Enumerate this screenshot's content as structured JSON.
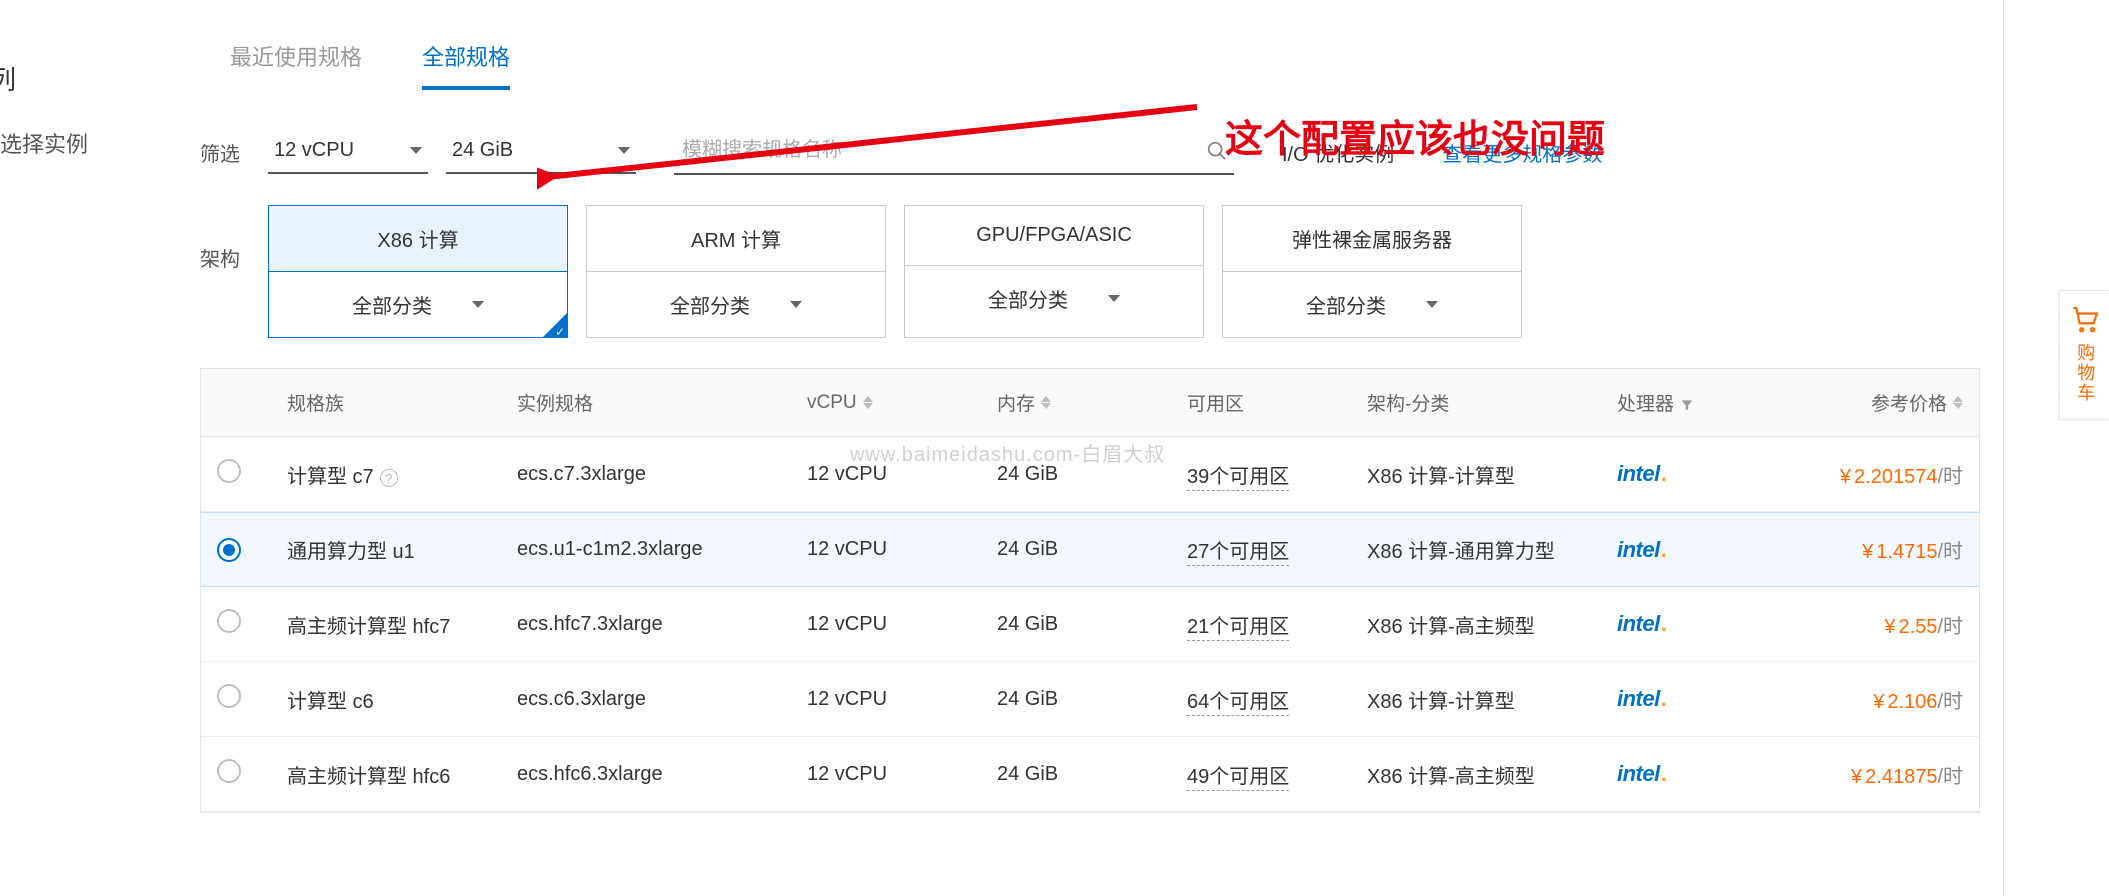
{
  "leftStrip": {
    "partialTitle": "列",
    "subtitle": "选择实例"
  },
  "tabs": {
    "recent": "最近使用规格",
    "all": "全部规格"
  },
  "filter": {
    "label": "筛选",
    "vcpu": "12 vCPU",
    "memory": "24 GiB",
    "searchPlaceholder": "模糊搜索规格名称",
    "ioOptimized": "I/O 优化实例",
    "moreLink": "查看更多规格参数"
  },
  "arch": {
    "label": "架构",
    "allCategory": "全部分类",
    "cards": [
      {
        "name": "X86 计算",
        "selected": true
      },
      {
        "name": "ARM 计算",
        "selected": false
      },
      {
        "name": "GPU/FPGA/ASIC",
        "selected": false
      },
      {
        "name": "弹性裸金属服务器",
        "selected": false
      }
    ]
  },
  "table": {
    "headers": {
      "family": "规格族",
      "spec": "实例规格",
      "vcpu": "vCPU",
      "memory": "内存",
      "zone": "可用区",
      "archCat": "架构-分类",
      "processor": "处理器",
      "price": "参考价格"
    },
    "rows": [
      {
        "selected": false,
        "family": "计算型 c7",
        "help": true,
        "spec": "ecs.c7.3xlarge",
        "vcpu": "12 vCPU",
        "memory": "24 GiB",
        "zone": "39个可用区",
        "archCat": "X86 计算-计算型",
        "processor": "intel",
        "price": "2.201574",
        "suffix": "/时"
      },
      {
        "selected": true,
        "family": "通用算力型 u1",
        "help": false,
        "spec": "ecs.u1-c1m2.3xlarge",
        "vcpu": "12 vCPU",
        "memory": "24 GiB",
        "zone": "27个可用区",
        "archCat": "X86 计算-通用算力型",
        "processor": "intel",
        "price": "1.4715",
        "suffix": "/时"
      },
      {
        "selected": false,
        "family": "高主频计算型 hfc7",
        "help": false,
        "spec": "ecs.hfc7.3xlarge",
        "vcpu": "12 vCPU",
        "memory": "24 GiB",
        "zone": "21个可用区",
        "archCat": "X86 计算-高主频型",
        "processor": "intel",
        "price": "2.55",
        "suffix": "/时"
      },
      {
        "selected": false,
        "family": "计算型 c6",
        "help": false,
        "spec": "ecs.c6.3xlarge",
        "vcpu": "12 vCPU",
        "memory": "24 GiB",
        "zone": "64个可用区",
        "archCat": "X86 计算-计算型",
        "processor": "intel",
        "price": "2.106",
        "suffix": "/时"
      },
      {
        "selected": false,
        "family": "高主频计算型 hfc6",
        "help": false,
        "spec": "ecs.hfc6.3xlarge",
        "vcpu": "12 vCPU",
        "memory": "24 GiB",
        "zone": "49个可用区",
        "archCat": "X86 计算-高主频型",
        "processor": "intel",
        "price": "2.41875",
        "suffix": "/时"
      }
    ]
  },
  "annotation": "这个配置应该也没问题",
  "cartLabel": "购物车",
  "watermark": "www.baimeidashu.com-白眉大叔"
}
